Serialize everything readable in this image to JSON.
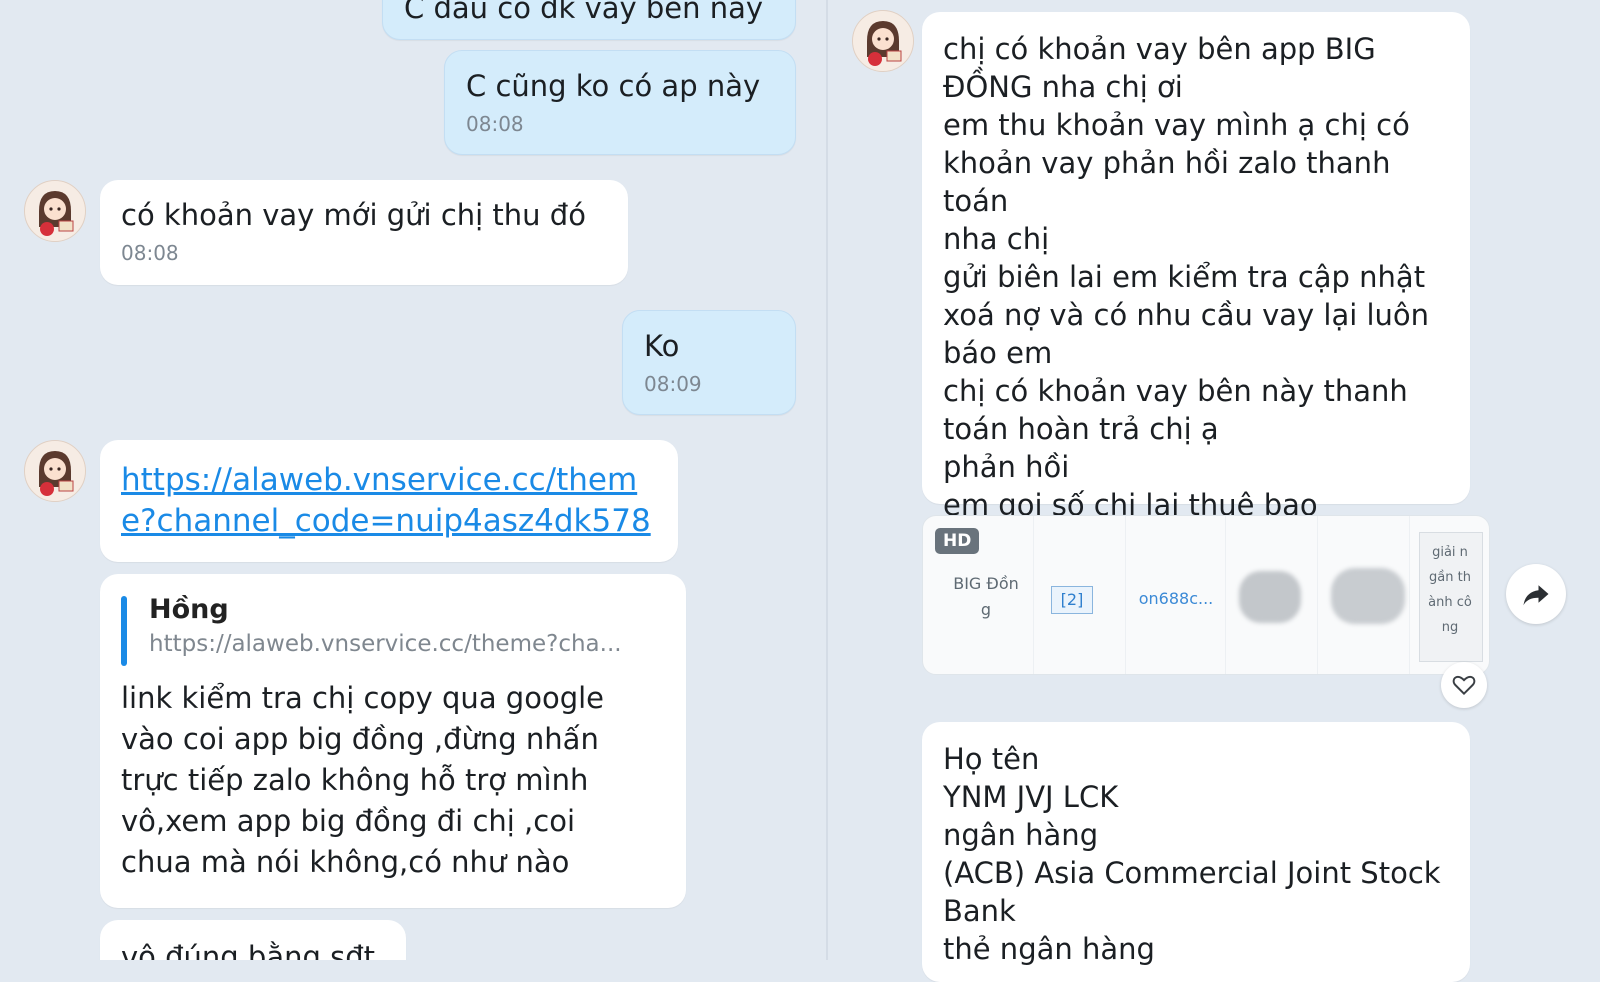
{
  "left_messages": {
    "m0_text": "C đâu có dk vay bên này",
    "m1_text": "C cũng ko có ap này",
    "m1_time": "08:08",
    "m2_text": "có khoản vay mới gửi chị thu đó",
    "m2_time": "08:08",
    "m3_text": "Ko",
    "m3_time": "08:09",
    "m4_link": "https://alaweb.vnservice.cc/theme?channel_code=nuip4asz4dk578",
    "m5_quote_name": "Hồng",
    "m5_quote_url": "https://alaweb.vnservice.cc/theme?cha...",
    "m5_text": "link kiểm tra chị copy qua google\nvào coi app big đồng ,đừng nhấn\ntrực tiếp zalo không hỗ trợ mình\nvô,xem app big đồng đi chị ,coi\nchua mà nói không,có như nào",
    "m6_text": "vô đúng bằng sđt"
  },
  "right_messages": {
    "r1_text": "chị có khoản vay bên app BIG\nĐỒNG nha chị ơi\nem thu khoản vay mình ạ chị có\nkhoản vay phản hồi zalo thanh toán\nnha chị\ngửi biên lai em kiểm tra cập nhật\nxoá nợ và có nhu cầu vay lại luôn\nbáo em\nchị có khoản vay bên này thanh\ntoán hoàn trả chị ạ\nphản hồi\nem gọi số chị lại thuê bao",
    "card": {
      "badge": "HD",
      "col1": "BIG Đồn\ng",
      "col2": "[2]",
      "col3": "on688c...",
      "col6": "giải n\ngần th\nành cô\nng"
    },
    "r2_text": "Họ tên\nYNM JVJ LCK\nngân hàng\n(ACB) Asia Commercial Joint Stock\nBank\nthẻ ngân hàng"
  },
  "colors": {
    "background": "#e2e9f1",
    "bubble_incoming": "#ffffff",
    "bubble_outgoing": "#d4ecfb",
    "link": "#1a8ae6",
    "timestamp": "#7d8791"
  },
  "icons": [
    "avatar-icon",
    "share-arrow-icon",
    "heart-icon"
  ]
}
